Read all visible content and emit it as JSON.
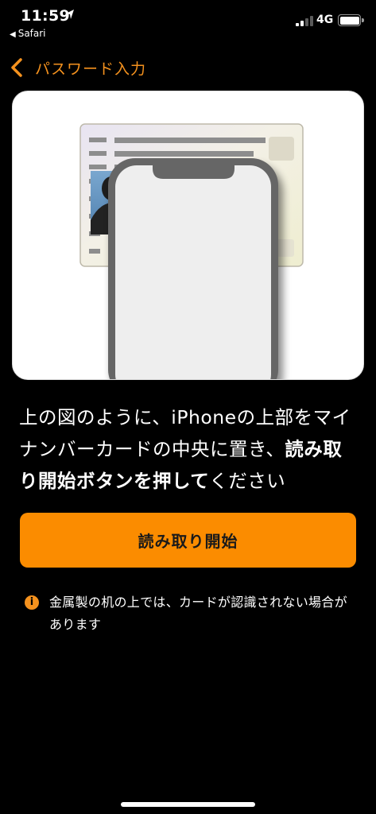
{
  "status_bar": {
    "time": "11:59",
    "location_icon": "location-arrow-icon",
    "back_app": "Safari",
    "network": "4G"
  },
  "nav": {
    "back_icon": "chevron-left-icon",
    "title": "パスワード入力"
  },
  "illustration": {
    "description_icon": "card-and-phone-illustration"
  },
  "instruction": {
    "part1": "上の図のように、iPhoneの上部をマイナンバーカードの中央に置き、",
    "bold": "読み取り開始ボタンを押して",
    "part2": "ください"
  },
  "button": {
    "label": "読み取り開始"
  },
  "note": {
    "icon": "info-icon",
    "icon_glyph": "i",
    "text": "金属製の机の上では、カードが認識されない場合があります"
  },
  "colors": {
    "accent": "#f5921e",
    "button": "#fb8c00",
    "background": "#000000"
  }
}
